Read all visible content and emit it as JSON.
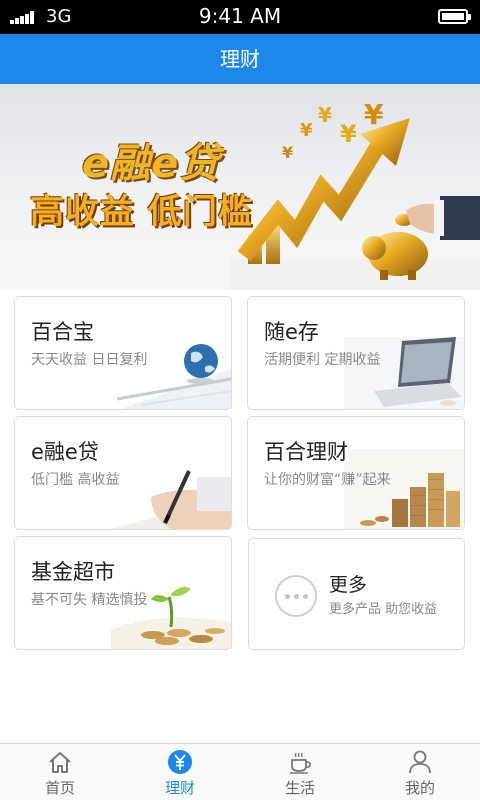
{
  "status_bar": {
    "carrier": "3G",
    "time": "9:41 AM"
  },
  "nav": {
    "title": "理财"
  },
  "banner": {
    "line1": "e融e贷",
    "line2": "高收益 低门槛"
  },
  "products": [
    {
      "title": "百合宝",
      "subtitle": "天天收益 日日复利"
    },
    {
      "title": "随e存",
      "subtitle": "活期便利 定期收益"
    },
    {
      "title": "e融e贷",
      "subtitle": "低门槛 高收益"
    },
    {
      "title": "百合理财",
      "subtitle": "让你的财富“赚”起来"
    },
    {
      "title": "基金超市",
      "subtitle": "基不可失 精选慎投"
    }
  ],
  "more": {
    "title": "更多",
    "subtitle": "更多产品 助您收益"
  },
  "tabs": [
    {
      "label": "首页",
      "icon": "home-icon",
      "active": false
    },
    {
      "label": "理财",
      "icon": "yuan-icon",
      "active": true
    },
    {
      "label": "生活",
      "icon": "coffee-cup-icon",
      "active": false
    },
    {
      "label": "我的",
      "icon": "person-icon",
      "active": false
    }
  ],
  "colors": {
    "accent": "#1e88ea",
    "banner_gold": "#f0b52a"
  }
}
